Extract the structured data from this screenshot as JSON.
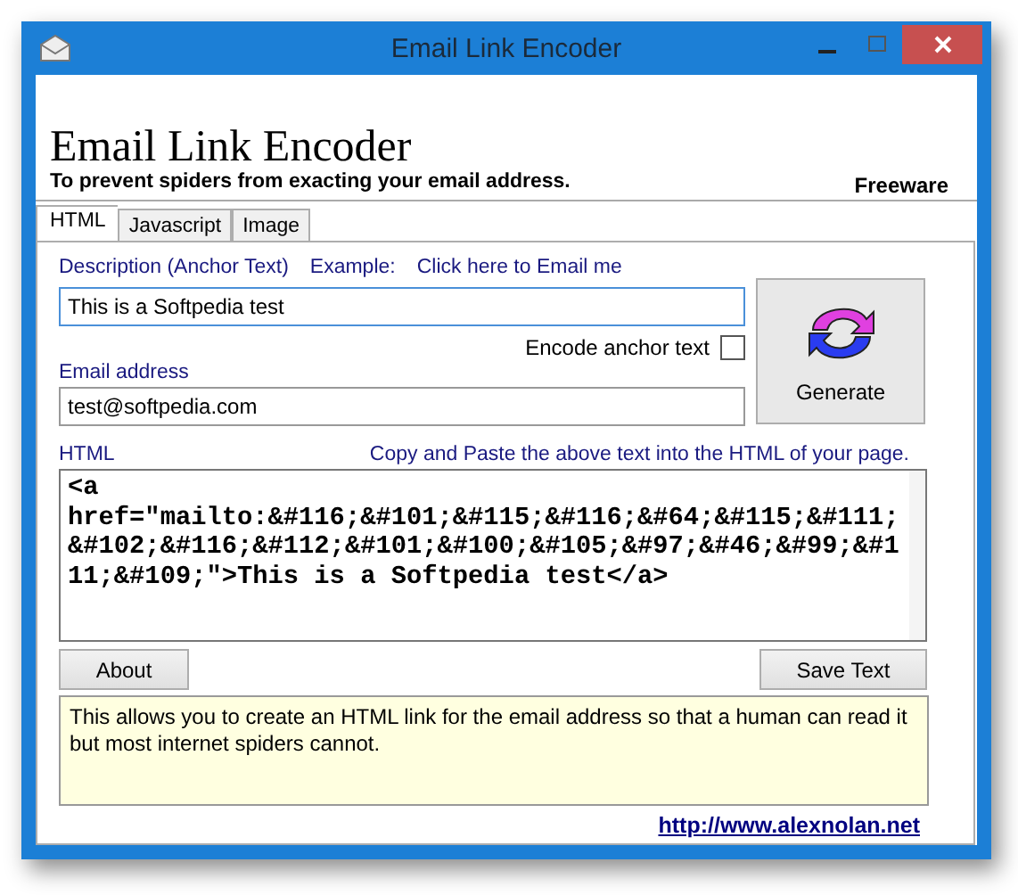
{
  "window": {
    "title": "Email Link Encoder"
  },
  "header": {
    "title": "Email Link Encoder",
    "subtitle": "To prevent spiders from exacting your email address.",
    "license": "Freeware"
  },
  "tabs": [
    {
      "label": "HTML",
      "selected": true
    },
    {
      "label": "Javascript",
      "selected": false
    },
    {
      "label": "Image",
      "selected": false
    }
  ],
  "description": {
    "label": "Description (Anchor Text)",
    "example_label": "Example:",
    "example": "Click here to Email me",
    "value": "This is a Softpedia test"
  },
  "encode_anchor": {
    "label": "Encode anchor text",
    "checked": false
  },
  "email": {
    "label": "Email address",
    "value": "test@softpedia.com"
  },
  "generate_button": "Generate",
  "html": {
    "label": "HTML",
    "hint": "Copy and Paste the above text into the HTML of your page.",
    "value": "<a href=\"mailto:&#116;&#101;&#115;&#116;&#64;&#115;&#111;&#102;&#116;&#112;&#101;&#100;&#105;&#97;&#46;&#99;&#111;&#109;\">This is a Softpedia test</a>"
  },
  "buttons": {
    "about": "About",
    "save": "Save Text"
  },
  "info": "This allows you to create an HTML link for the email address so that a human can read it but most internet spiders cannot.",
  "link": "http://www.alexnolan.net"
}
